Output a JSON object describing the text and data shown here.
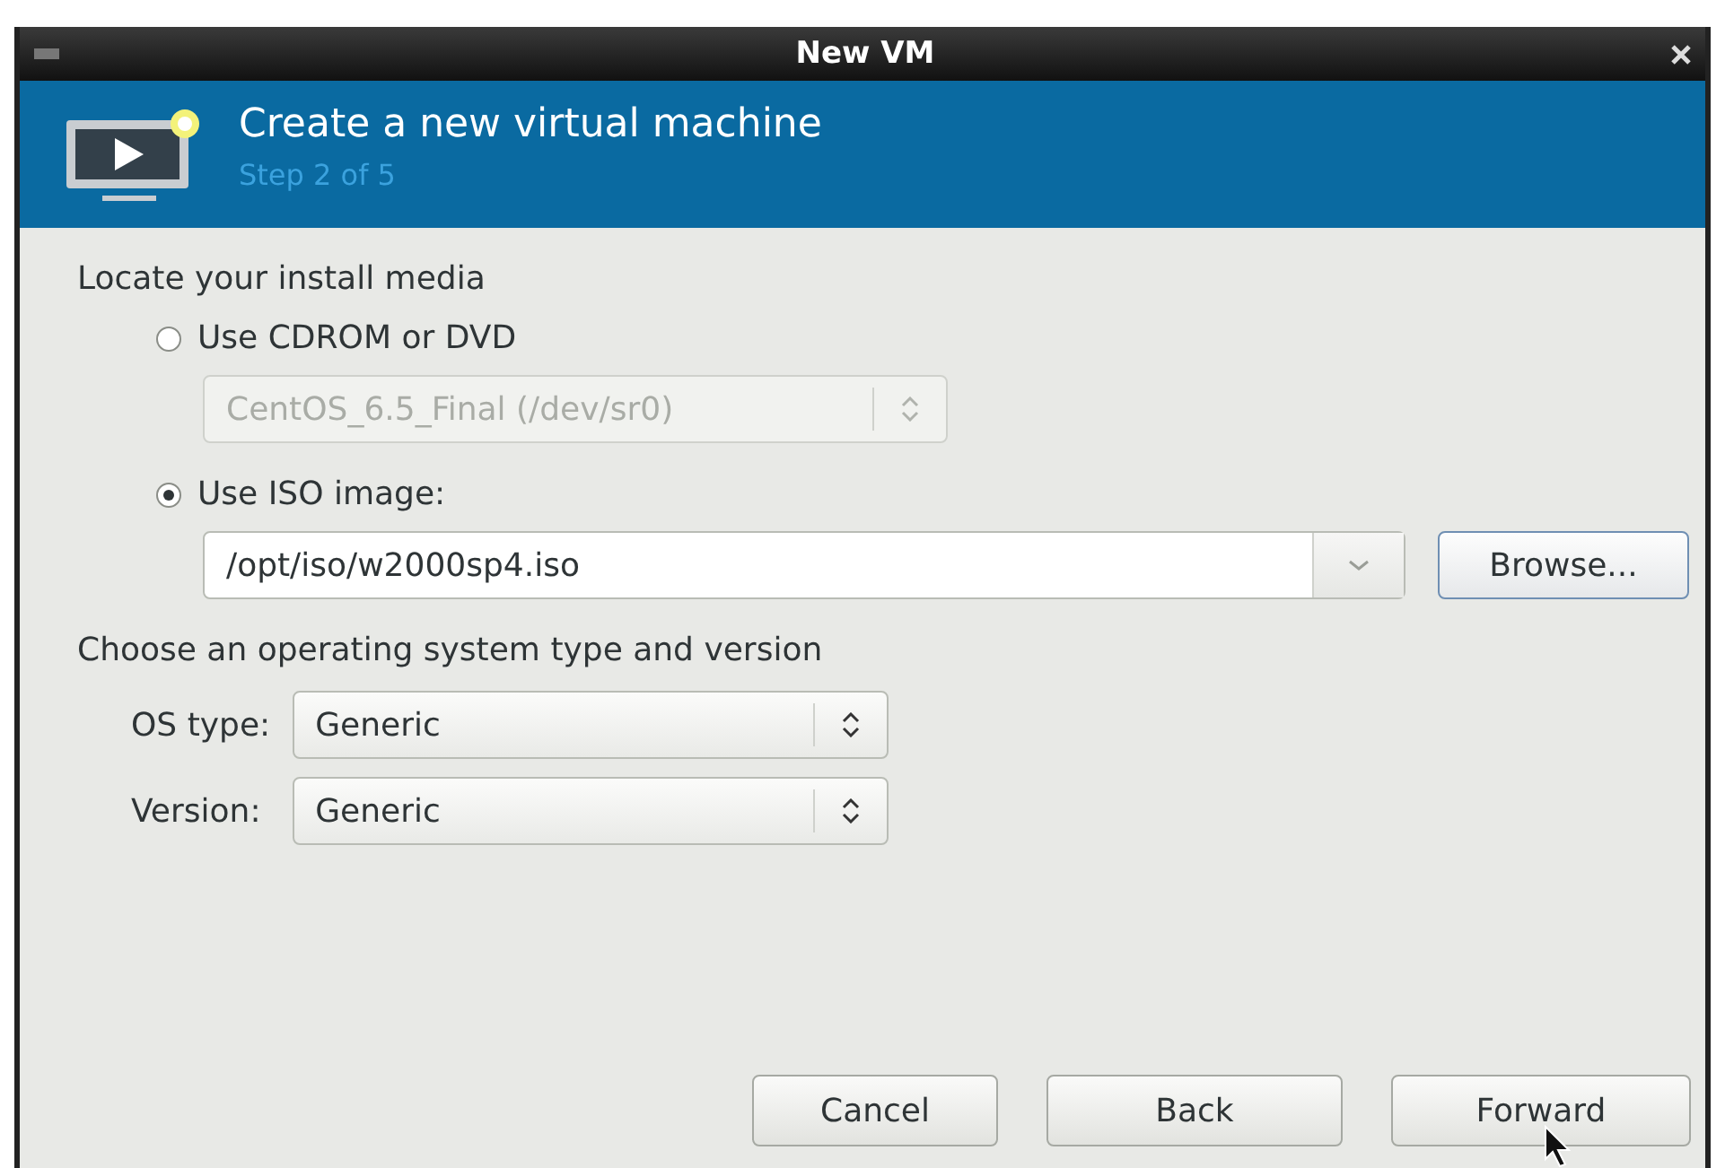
{
  "window": {
    "title": "New VM"
  },
  "header": {
    "title": "Create a new virtual machine",
    "step": "Step 2 of 5"
  },
  "install_media": {
    "heading": "Locate your install media",
    "options": [
      {
        "kind": "device",
        "label": "Use CDROM or DVD",
        "selected": false,
        "value": "CentOS_6.5_Final (/dev/sr0)",
        "disabled": true
      },
      {
        "kind": "iso",
        "label": "Use ISO image:",
        "selected": true,
        "value": "/opt/iso/w2000sp4.iso",
        "browse": "Browse..."
      }
    ]
  },
  "os": {
    "heading": "Choose an operating system type and version",
    "fields": [
      {
        "label": "OS type:",
        "value": "Generic"
      },
      {
        "label": "Version:",
        "value": "Generic"
      }
    ]
  },
  "buttons": [
    "Cancel",
    "Back",
    "Forward"
  ]
}
